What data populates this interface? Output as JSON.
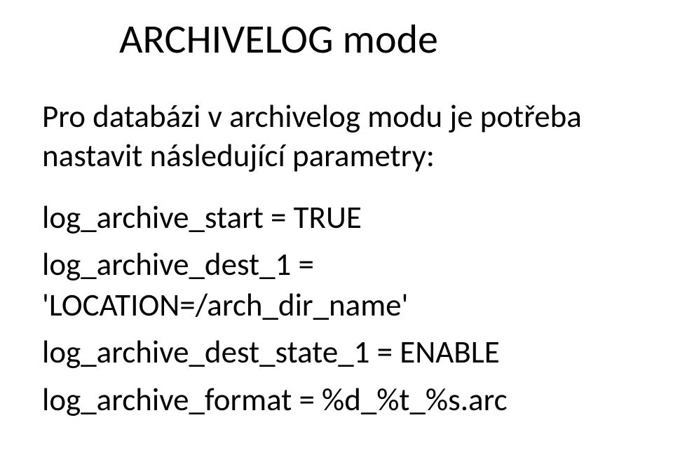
{
  "title": "ARCHIVELOG mode",
  "intro": "Pro databázi v archivelog modu je potřeba nastavit následující parametry:",
  "params": {
    "p1": "log_archive_start = TRUE",
    "p2": "log_archive_dest_1 = 'LOCATION=/arch_dir_name'",
    "p3": "log_archive_dest_state_1 = ENABLE",
    "p4": "log_archive_format = %d_%t_%s.arc"
  }
}
